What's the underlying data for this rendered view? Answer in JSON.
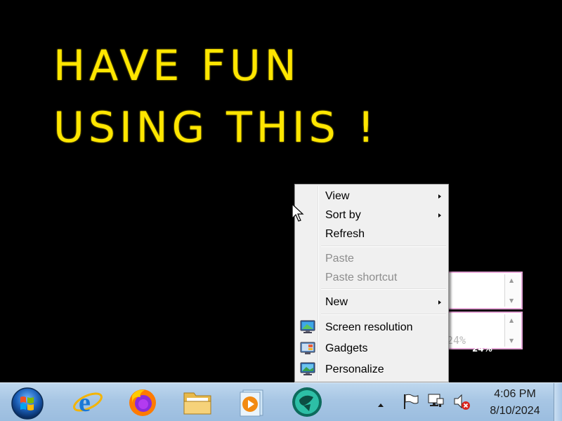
{
  "wallpaper": {
    "line1": "HAVE FUN",
    "line2": "USING THIS !"
  },
  "gadgets": {
    "percent_value": "24%",
    "percent_shadow": "24%"
  },
  "context_menu": {
    "items": [
      {
        "label": "View",
        "submenu": true,
        "disabled": false
      },
      {
        "label": "Sort by",
        "submenu": true,
        "disabled": false
      },
      {
        "label": "Refresh",
        "submenu": false,
        "disabled": false
      },
      {
        "label": "Paste",
        "submenu": false,
        "disabled": true
      },
      {
        "label": "Paste shortcut",
        "submenu": false,
        "disabled": true
      },
      {
        "label": "New",
        "submenu": true,
        "disabled": false
      },
      {
        "label": "Screen resolution",
        "icon": "monitor-icon",
        "disabled": false
      },
      {
        "label": "Gadgets",
        "icon": "gadgets-icon",
        "disabled": false
      },
      {
        "label": "Personalize",
        "icon": "personalize-icon",
        "disabled": false
      }
    ]
  },
  "taskbar": {
    "pinned": [
      {
        "name": "Internet Explorer",
        "icon": "internet-explorer-icon"
      },
      {
        "name": "Firefox",
        "icon": "firefox-icon"
      },
      {
        "name": "File Explorer",
        "icon": "folder-icon"
      },
      {
        "name": "Media Player",
        "icon": "media-player-icon"
      },
      {
        "name": "App",
        "icon": "app-icon"
      }
    ],
    "tray": {
      "icons": [
        "show-hidden-icons-arrow",
        "action-center-flag-icon",
        "network-icon",
        "volume-muted-icon"
      ]
    },
    "clock": {
      "time": "4:06 PM",
      "date": "8/10/2024"
    }
  },
  "colors": {
    "wallpaper_text": "#ffe600",
    "desktop_background": "#000000",
    "menu_background": "#f0f0f0",
    "taskbar": "#a7c6e4",
    "gadget_border": "#e4a6d6"
  }
}
